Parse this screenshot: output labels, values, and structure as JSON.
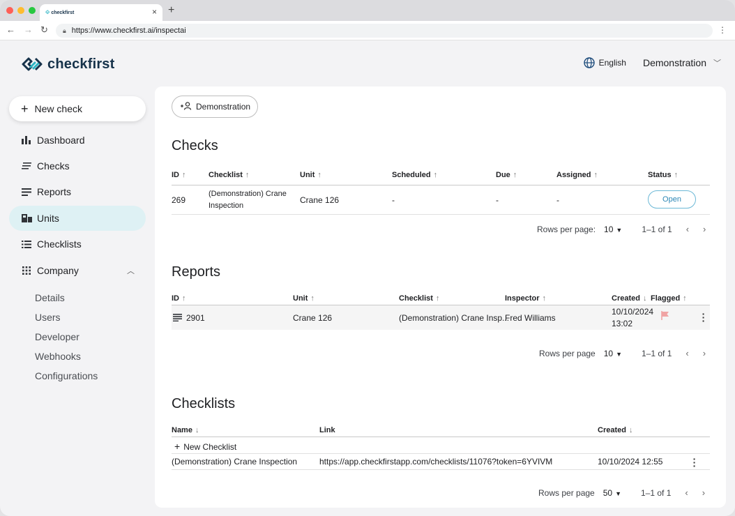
{
  "browser": {
    "tab_title": "checkfirst",
    "url": "https://www.checkfirst.ai/inspectai"
  },
  "header": {
    "logo_text": "checkfirst",
    "language": "English",
    "organization": "Demonstration"
  },
  "sidebar": {
    "new_check": "New check",
    "items": [
      {
        "label": "Dashboard",
        "icon": "bar-chart-icon"
      },
      {
        "label": "Checks",
        "icon": "checks-list-icon"
      },
      {
        "label": "Reports",
        "icon": "reports-icon"
      },
      {
        "label": "Units",
        "icon": "units-icon",
        "active": true
      },
      {
        "label": "Checklists",
        "icon": "checklists-icon"
      },
      {
        "label": "Company",
        "icon": "grid-dots-icon",
        "expanded": true
      }
    ],
    "company_sub": [
      "Details",
      "Users",
      "Developer",
      "Webhooks",
      "Configurations"
    ]
  },
  "main": {
    "chip_label": "Demonstration",
    "checks": {
      "title": "Checks",
      "columns": [
        "ID",
        "Checklist",
        "Unit",
        "Scheduled",
        "Due",
        "Assigned",
        "Status"
      ],
      "rows": [
        {
          "id": "269",
          "checklist_line1": "(Demonstration) Crane",
          "checklist_line2": "Inspection",
          "unit": "Crane 126",
          "scheduled": "-",
          "due": "-",
          "assigned": "-",
          "status": "Open"
        }
      ],
      "pager": {
        "rows_per_page_label": "Rows per page:",
        "rows_per_page": "10",
        "range": "1–1 of 1"
      }
    },
    "reports": {
      "title": "Reports",
      "columns": [
        "ID",
        "Unit",
        "Checklist",
        "Inspector",
        "Created",
        "Flagged"
      ],
      "rows": [
        {
          "id": "2901",
          "unit": "Crane 126",
          "checklist": "(Demonstration) Crane Insp...",
          "inspector": "Fred Williams",
          "created_date": "10/10/2024",
          "created_time": "13:02",
          "flagged": true
        }
      ],
      "pager": {
        "rows_per_page_label": "Rows per page",
        "rows_per_page": "10",
        "range": "1–1 of 1"
      }
    },
    "checklists": {
      "title": "Checklists",
      "columns": [
        "Name",
        "Link",
        "Created"
      ],
      "new_label": "New Checklist",
      "rows": [
        {
          "name": "(Demonstration) Crane Inspection",
          "link": "https://app.checkfirstapp.com/checklists/11076?token=6YVIVM",
          "created": "10/10/2024 12:55"
        }
      ],
      "pager": {
        "rows_per_page_label": "Rows per page",
        "rows_per_page": "50",
        "range": "1–1 of 1"
      }
    }
  },
  "colors": {
    "brand_dark": "#16324a",
    "brand_teal": "#2ab4c4",
    "active_nav": "#def1f4",
    "open_border": "#6bb8d6",
    "flag": "#f0a4a4"
  }
}
